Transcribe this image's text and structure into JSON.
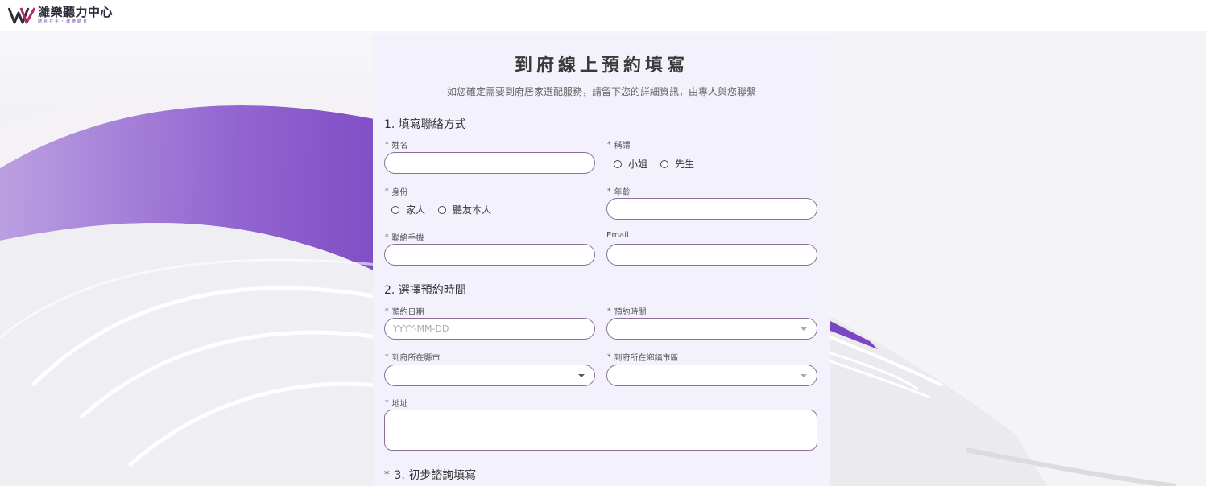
{
  "brand": {
    "name": "濰樂聽力中心",
    "slogan": "聽見在乎・濰樂聽見",
    "accent": "#7b4fb0"
  },
  "form": {
    "title": "到府線上預約填寫",
    "subtitle": "如您確定需要到府居家選配服務，請留下您的詳細資訊，由專人與您聯繫",
    "required_mark": "*",
    "section1": "1. 填寫聯絡方式",
    "section2": "2. 選擇預約時間",
    "section3": "3. 初步諮詢填寫",
    "fields": {
      "name": {
        "label": "姓名",
        "value": ""
      },
      "salutation": {
        "label": "稱謂",
        "options": [
          "小姐",
          "先生"
        ]
      },
      "identity": {
        "label": "身份",
        "options": [
          "家人",
          "聽友本人"
        ]
      },
      "age": {
        "label": "年齡",
        "value": ""
      },
      "phone": {
        "label": "聯絡手機",
        "value": ""
      },
      "email": {
        "label": "Email",
        "value": ""
      },
      "date": {
        "label": "預約日期",
        "placeholder": "YYYY-MM-DD"
      },
      "time": {
        "label": "預約時間",
        "value": ""
      },
      "county": {
        "label": "到府所在縣市",
        "value": ""
      },
      "district": {
        "label": "到府所在鄉鎮市區",
        "value": ""
      },
      "address": {
        "label": "地址",
        "value": ""
      }
    }
  }
}
